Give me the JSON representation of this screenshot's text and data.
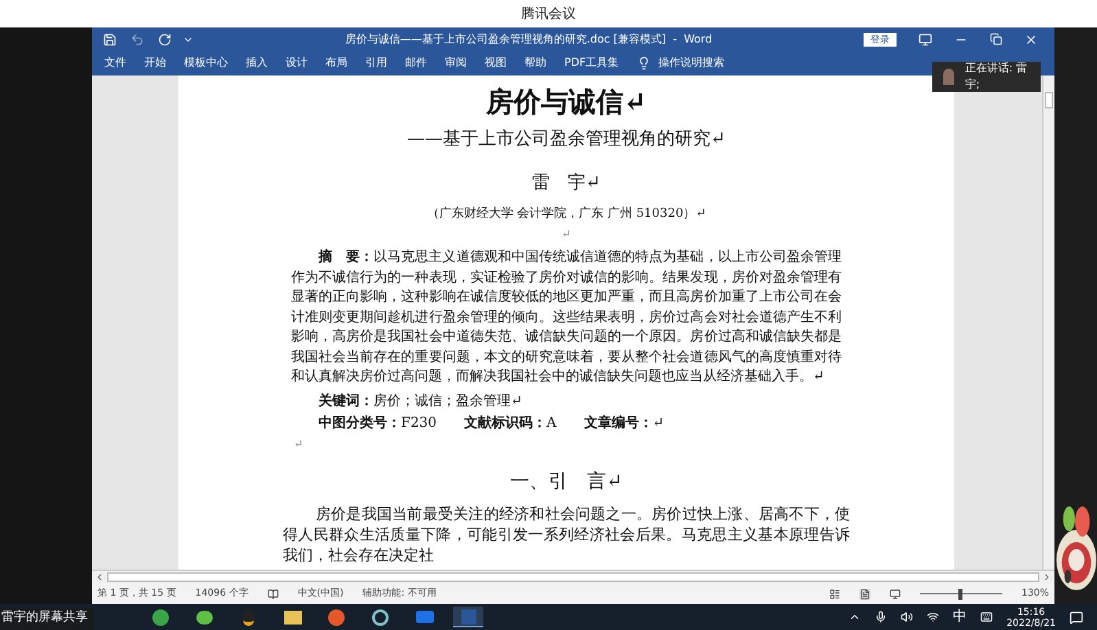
{
  "meeting": {
    "title": "腾讯会议",
    "speaker": "正在讲话: 雷宇;",
    "share_label": "雷宇的屏幕共享"
  },
  "window": {
    "title": "房价与诚信——基于上市公司盈余管理视角的研究.doc [兼容模式]  -  Word",
    "login": "登录"
  },
  "ribbon": {
    "tabs": [
      "文件",
      "开始",
      "模板中心",
      "插入",
      "设计",
      "布局",
      "引用",
      "邮件",
      "审阅",
      "视图",
      "帮助",
      "PDF工具集"
    ],
    "search": "操作说明搜索"
  },
  "document": {
    "title": "房价与诚信↵",
    "subtitle": "——基于上市公司盈余管理视角的研究↵",
    "author": "雷　宇↵",
    "affiliation": "（广东财经大学 会计学院，广东 广州 510320）↵",
    "blank": "↵",
    "abstract": "**摘　要：**以马克思主义道德观和中国传统诚信道德的特点为基础，以上市公司盈余管理作为不诚信行为的一种表现，实证检验了房价对诚信的影响。结果发现，房价对盈余管理有显著的正向影响，这种影响在诚信度较低的地区更加严重，而且高房价加重了上市公司在会计准则变更期间趁机进行盈余管理的倾向。这些结果表明，房价过高会对社会道德产生不利影响，高房价是我国社会中道德失范、诚信缺失问题的一个原因。房价过高和诚信缺失都是我国社会当前存在的重要问题，本文的研究意味着，要从整个社会道德风气的高度慎重对待和认真解决房价过高问题，而解决我国社会中的诚信缺失问题也应当从经济基础入手。↵",
    "keywords": "**关键词：**房价；诚信；盈余管理↵",
    "classification": "**中图分类号：**F230　　**文献标识码：**A　　**文章编号：**↵",
    "blank2": "↵",
    "section": "一、引　言↵",
    "body": "房价是我国当前最受关注的经济和社会问题之一。房价过快上涨、居高不下，使得人民群众生活质量下降，可能引发一系列经济社会后果。马克思主义基本原理告诉我们，社会存在决定社"
  },
  "status_bar": {
    "page": "第 1 页，共 15 页",
    "words": "14096 个字",
    "language": "中文(中国)",
    "accessibility": "辅助功能: 不可用",
    "zoom": "130%",
    "zoom_level": {
      "level": 0.5
    }
  },
  "taskbar": {
    "ime": "中",
    "time": "15:16",
    "date": "2022/8/21"
  }
}
